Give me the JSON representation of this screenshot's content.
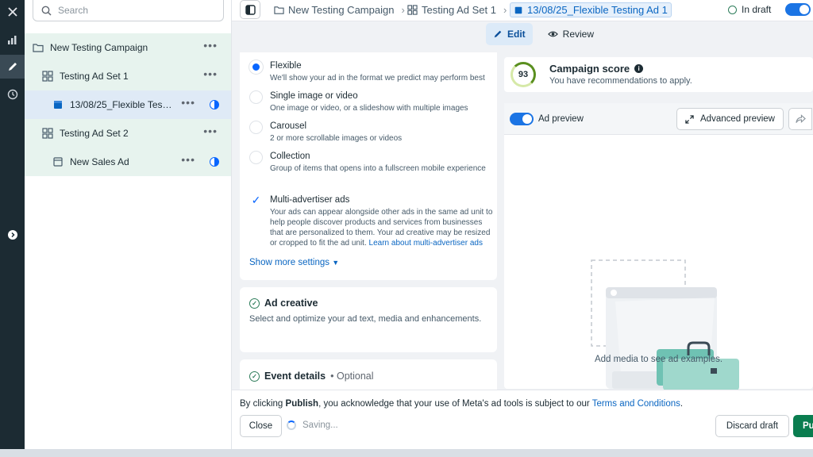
{
  "tree": {
    "search_placeholder": "Search",
    "items": [
      {
        "label": "New Testing Campaign",
        "icon": "folder-icon"
      },
      {
        "label": "Testing Ad Set 1",
        "icon": "grid-icon"
      },
      {
        "label": "13/08/25_Flexible Testi...",
        "icon": "ad-icon"
      },
      {
        "label": "Testing Ad Set 2",
        "icon": "grid-icon"
      },
      {
        "label": "New Sales Ad",
        "icon": "ad-icon"
      }
    ]
  },
  "topbar": {
    "breadcrumbs": [
      "New Testing Campaign",
      "Testing Ad Set 1",
      "13/08/25_Flexible Testing Ad 1"
    ],
    "status": "In draft"
  },
  "modes": {
    "edit": "Edit",
    "review": "Review"
  },
  "format": {
    "options": [
      {
        "title": "Flexible",
        "desc": "We'll show your ad in the format we predict may perform best"
      },
      {
        "title": "Single image or video",
        "desc": "One image or video, or a slideshow with multiple images"
      },
      {
        "title": "Carousel",
        "desc": "2 or more scrollable images or videos"
      },
      {
        "title": "Collection",
        "desc": "Group of items that opens into a fullscreen mobile experience"
      }
    ],
    "multi_advertiser": {
      "title": "Multi-advertiser ads",
      "desc_lines": [
        "Your ads can appear alongside other ads in the same ad unit to",
        "help people discover products and services from businesses",
        "that are personalized to them. Your ad creative may be resized",
        "or cropped to fit the ad unit."
      ],
      "link": "Learn about multi-advertiser ads"
    },
    "show_more": "Show more settings"
  },
  "ad_creative": {
    "title": "Ad creative",
    "desc": "Select and optimize your ad text, media and enhancements."
  },
  "event_details": {
    "title": "Event details",
    "optional": "• Optional"
  },
  "score": {
    "value": "93",
    "title": "Campaign score",
    "subtitle": "You have recommendations to apply."
  },
  "preview": {
    "toggle_label": "Ad preview",
    "advanced": "Advanced preview",
    "empty": "Add media to see ad examples."
  },
  "footer": {
    "consent_prefix": "By clicking ",
    "consent_bold": "Publish",
    "consent_middle": ", you acknowledge that your use of Meta's ad tools is subject to our ",
    "consent_link": "Terms and Conditions",
    "consent_end": ".",
    "close": "Close",
    "saving": "Saving...",
    "discard": "Discard draft",
    "publish": "Pu"
  },
  "colors": {
    "accent": "#0866ff",
    "publish": "#0a7d4f",
    "rail": "#1c2b33"
  }
}
